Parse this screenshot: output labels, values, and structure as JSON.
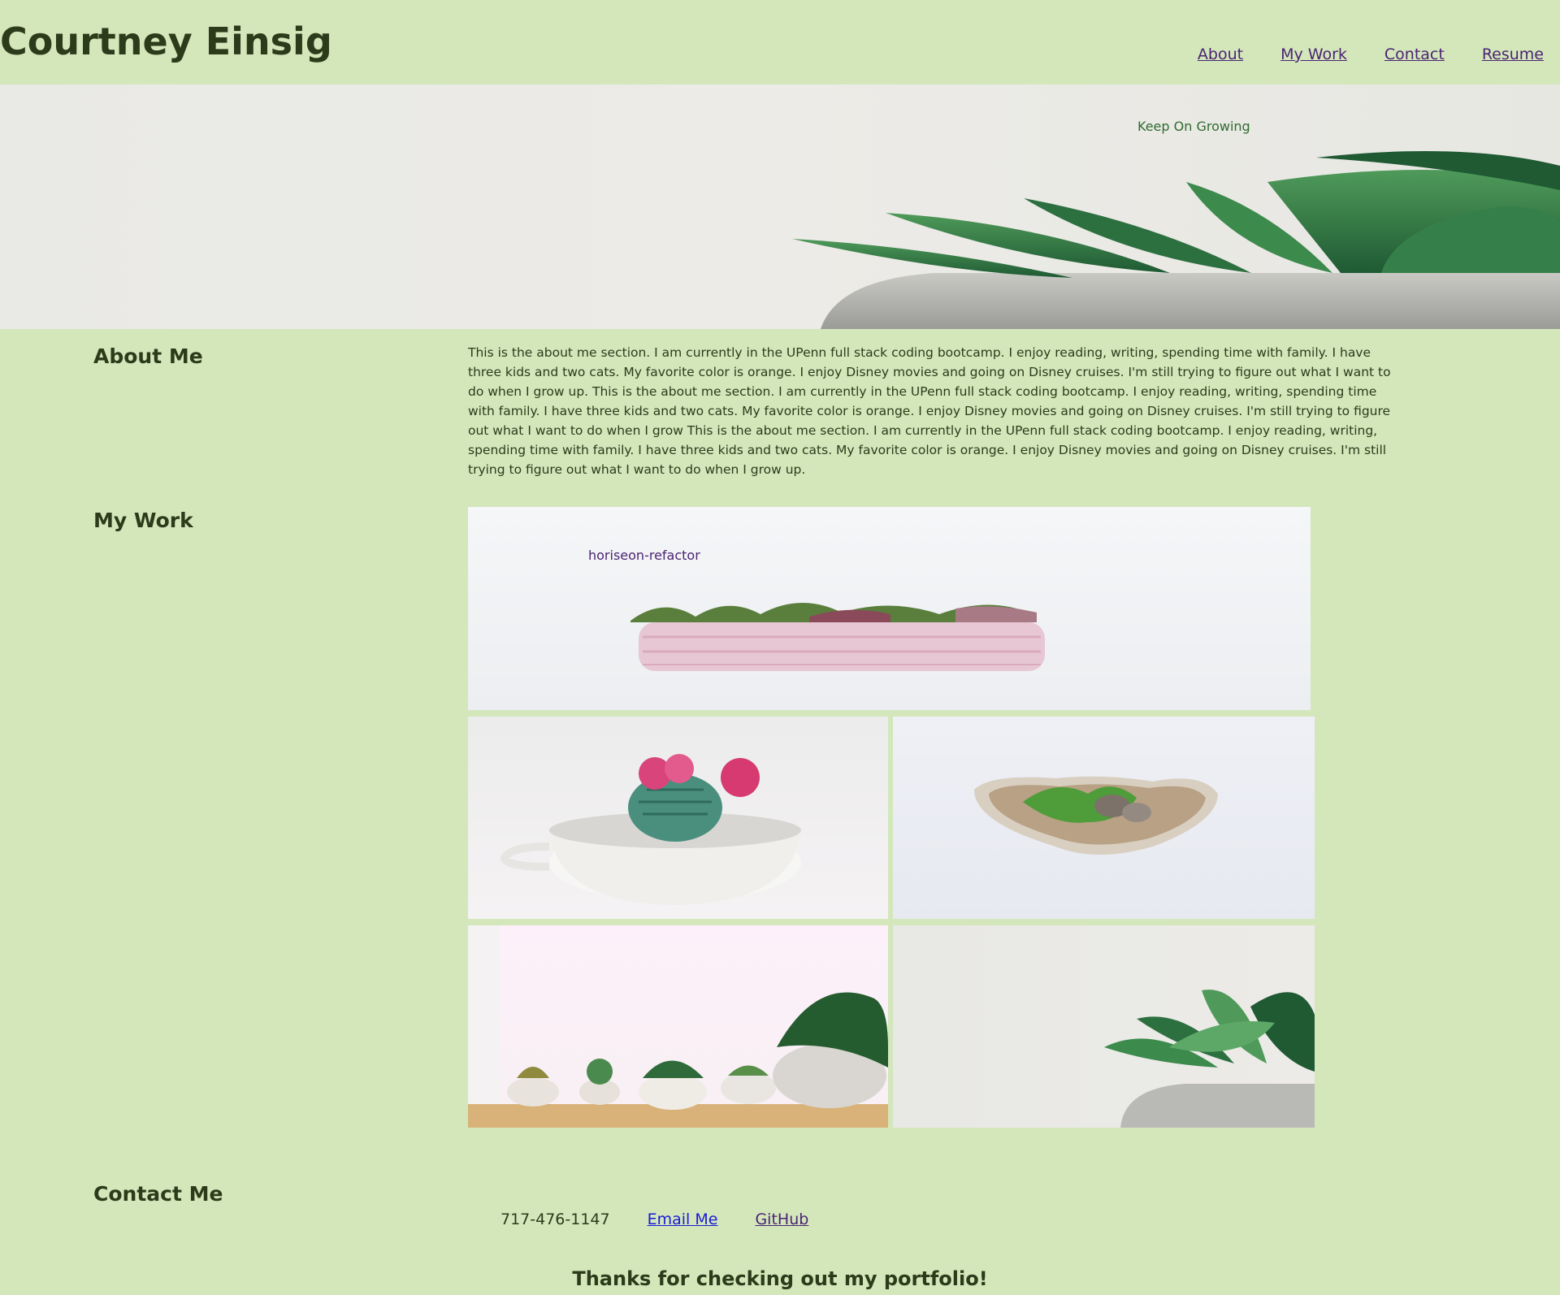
{
  "header": {
    "title": "Courtney Einsig",
    "nav": [
      {
        "label": "About"
      },
      {
        "label": "My Work"
      },
      {
        "label": "Contact"
      },
      {
        "label": "Resume"
      }
    ]
  },
  "hero": {
    "tagline": "Keep On Growing"
  },
  "about": {
    "heading": "About Me",
    "text": "This is the about me section. I am currently in the UPenn full stack coding bootcamp. I enjoy reading, writing, spending time with family. I have three kids and two cats. My favorite color is orange. I enjoy Disney movies and going on Disney cruises. I'm still trying to figure out what I want to do when I grow up. This is the about me section. I am currently in the UPenn full stack coding bootcamp. I enjoy reading, writing, spending time with family. I have three kids and two cats. My favorite color is orange. I enjoy Disney movies and going on Disney cruises. I'm still trying to figure out what I want to do when I grow This is the about me section. I am currently in the UPenn full stack coding bootcamp. I enjoy reading, writing, spending time with family. I have three kids and two cats. My favorite color is orange. I enjoy Disney movies and going on Disney cruises. I'm still trying to figure out what I want to do when I grow up."
  },
  "work": {
    "heading": "My Work",
    "featured_label": "horiseon-refactor"
  },
  "contact": {
    "heading": "Contact Me",
    "phone": "717-476-1147",
    "email_label": "Email Me",
    "github_label": "GitHub"
  },
  "footer": {
    "thanks": "Thanks for checking out my portfolio!"
  }
}
